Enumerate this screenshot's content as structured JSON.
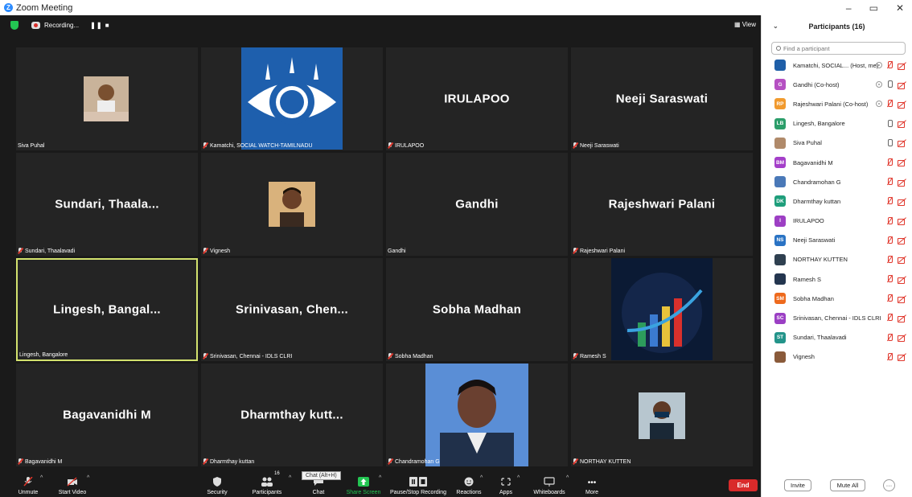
{
  "window": {
    "title": "Zoom Meeting",
    "minimize": "–",
    "restore": "▭",
    "close": "✕"
  },
  "topbar": {
    "recording_text": "Recording...",
    "recording_controls": "❚❚ ■",
    "view_label": "▦ View"
  },
  "tiles": [
    {
      "label": "Siva Puhal",
      "big": "",
      "muted": false
    },
    {
      "label": "Kamatchi, SOCIAL WATCH-TAMILNADU",
      "big": "",
      "muted": true
    },
    {
      "label": "IRULAPOO",
      "big": "IRULAPOO",
      "muted": true
    },
    {
      "label": "Neeji Saraswati",
      "big": "Neeji Saraswati",
      "muted": true
    },
    {
      "label": "Sundari, Thaalavadi",
      "big": "Sundari,  Thaala...",
      "muted": true
    },
    {
      "label": "Vignesh",
      "big": "",
      "muted": true
    },
    {
      "label": "Gandhi",
      "big": "Gandhi",
      "muted": false
    },
    {
      "label": "Rajeshwari Palani",
      "big": "Rajeshwari Palani",
      "muted": true
    },
    {
      "label": "Lingesh, Bangalore",
      "big": "Lingesh,  Bangal...",
      "muted": false
    },
    {
      "label": "Srinivasan, Chennai - IDLS CLRI",
      "big": "Srinivasan,  Chen...",
      "muted": true
    },
    {
      "label": "Sobha Madhan",
      "big": "Sobha Madhan",
      "muted": true
    },
    {
      "label": "Ramesh S",
      "big": "",
      "muted": true
    },
    {
      "label": "Bagavanidhi M",
      "big": "Bagavanidhi M",
      "muted": true
    },
    {
      "label": "Dharmthay kuttan",
      "big": "Dharmthay  kutt...",
      "muted": true
    },
    {
      "label": "Chandramohan G",
      "big": "",
      "muted": true
    },
    {
      "label": "NORTHAY KUTTEN",
      "big": "",
      "muted": true
    }
  ],
  "toolbar": {
    "unmute": "Unmute",
    "start_video": "Start Video",
    "security": "Security",
    "participants": "Participants",
    "participants_count": "16",
    "chat": "Chat",
    "chat_tooltip": "Chat (Alt+H)",
    "share_screen": "Share Screen",
    "pause_stop": "Pause/Stop Recording",
    "reactions": "Reactions",
    "apps": "Apps",
    "whiteboards": "Whiteboards",
    "more": "More",
    "end": "End"
  },
  "panel": {
    "title": "Participants (16)",
    "search_placeholder": "Find a participant",
    "invite": "Invite",
    "mute_all": "Mute All",
    "more": "···",
    "participants": [
      {
        "name": "Kamatchi, SOCIAL... (Host, me)",
        "initials": "",
        "color": "#1f5fa8",
        "rec": true,
        "mic": "off"
      },
      {
        "name": "Gandhi (Co-host)",
        "initials": "G",
        "color": "#b550c2",
        "rec": true,
        "mic": "on"
      },
      {
        "name": "Rajeshwari Palani (Co-host)",
        "initials": "RP",
        "color": "#f19a2e",
        "rec": true,
        "mic": "off"
      },
      {
        "name": "Lingesh, Bangalore",
        "initials": "LB",
        "color": "#2c9e6a",
        "rec": false,
        "mic": "on-dark"
      },
      {
        "name": "Siva Puhal",
        "initials": "",
        "color": "#b08a6a",
        "rec": false,
        "mic": "on"
      },
      {
        "name": "Bagavanidhi M",
        "initials": "BM",
        "color": "#a43fc9",
        "rec": false,
        "mic": "off"
      },
      {
        "name": "Chandramohan G",
        "initials": "",
        "color": "#4a79b8",
        "rec": false,
        "mic": "off"
      },
      {
        "name": "Dharmthay kuttan",
        "initials": "DK",
        "color": "#1f9e7b",
        "rec": false,
        "mic": "off"
      },
      {
        "name": "IRULAPOO",
        "initials": "I",
        "color": "#9d3fc4",
        "rec": false,
        "mic": "off"
      },
      {
        "name": "Neeji Saraswati",
        "initials": "NS",
        "color": "#2a73c4",
        "rec": false,
        "mic": "off"
      },
      {
        "name": "NORTHAY KUTTEN",
        "initials": "",
        "color": "#2f4050",
        "rec": false,
        "mic": "off"
      },
      {
        "name": "Ramesh S",
        "initials": "",
        "color": "#24364f",
        "rec": false,
        "mic": "off"
      },
      {
        "name": "Sobha Madhan",
        "initials": "SM",
        "color": "#ee6a1d",
        "rec": false,
        "mic": "off"
      },
      {
        "name": "Srinivasan, Chennai - IDLS CLRI",
        "initials": "SC",
        "color": "#9b3fc4",
        "rec": false,
        "mic": "off"
      },
      {
        "name": "Sundari, Thaalavadi",
        "initials": "ST",
        "color": "#23948a",
        "rec": false,
        "mic": "off"
      },
      {
        "name": "Vignesh",
        "initials": "",
        "color": "#8a5a3a",
        "rec": false,
        "mic": "off"
      }
    ]
  }
}
